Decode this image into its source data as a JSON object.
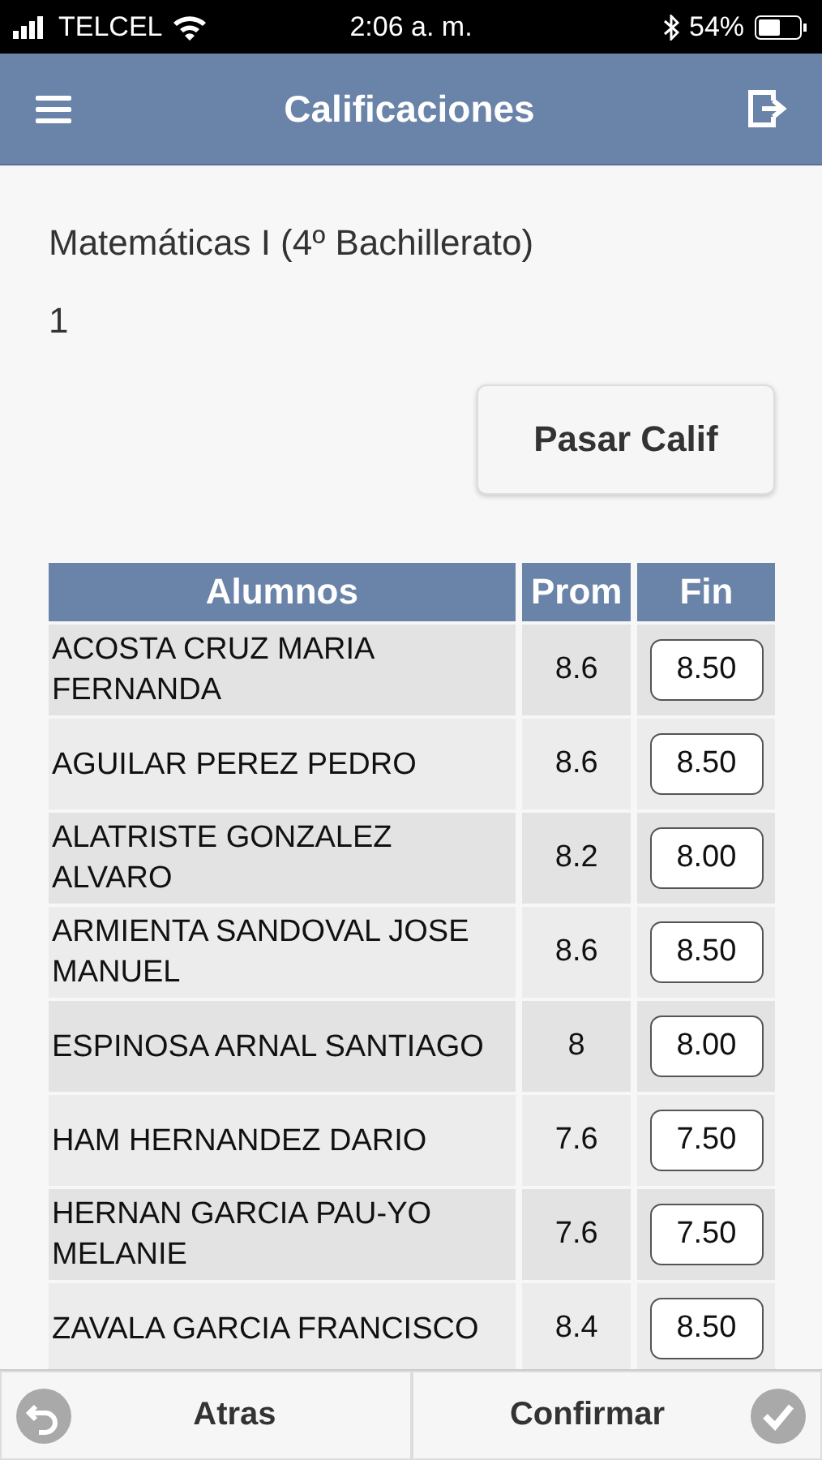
{
  "status_bar": {
    "carrier": "TELCEL",
    "time": "2:06 a. m.",
    "battery": "54%"
  },
  "header": {
    "title": "Calificaciones"
  },
  "subject": "Matemáticas I (4º Bachillerato)",
  "period": "1",
  "action_button": "Pasar Calif",
  "table": {
    "columns": [
      "Alumnos",
      "Prom",
      "Fin"
    ],
    "rows": [
      {
        "name": "ACOSTA CRUZ MARIA FERNANDA",
        "prom": "8.6",
        "fin": "8.50"
      },
      {
        "name": "AGUILAR PEREZ PEDRO",
        "prom": "8.6",
        "fin": "8.50"
      },
      {
        "name": "ALATRISTE GONZALEZ ALVARO",
        "prom": "8.2",
        "fin": "8.00"
      },
      {
        "name": "ARMIENTA SANDOVAL JOSE MANUEL",
        "prom": "8.6",
        "fin": "8.50"
      },
      {
        "name": "ESPINOSA ARNAL SANTIAGO",
        "prom": "8",
        "fin": "8.00"
      },
      {
        "name": "HAM HERNANDEZ DARIO",
        "prom": "7.6",
        "fin": "7.50"
      },
      {
        "name": "HERNAN GARCIA PAU-YO MELANIE",
        "prom": "7.6",
        "fin": "7.50"
      },
      {
        "name": "ZAVALA GARCIA FRANCISCO",
        "prom": "8.4",
        "fin": "8.50"
      }
    ]
  },
  "footer": {
    "back": "Atras",
    "confirm": "Confirmar"
  }
}
